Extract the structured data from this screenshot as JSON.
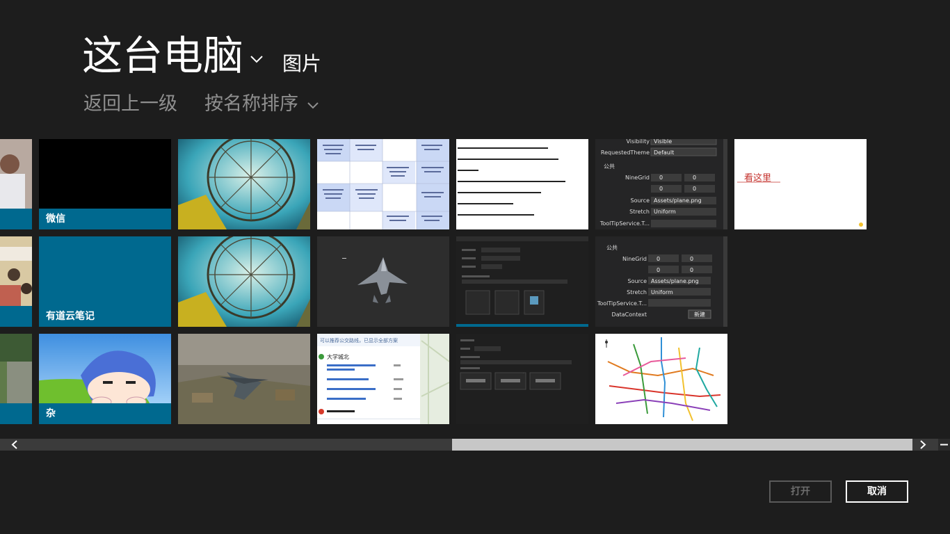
{
  "header": {
    "location_title": "这台电脑",
    "location_subtitle": "图片",
    "back_label": "返回上一级",
    "sort_label": "按名称排序"
  },
  "tiles": {
    "wechat_label": "微信",
    "youdao_label": "有道云笔记",
    "misc_label": "杂",
    "vs_row1_visibility_label": "Visibility",
    "vs_row1_visibility_value": "Visible",
    "vs_row1_theme_label": "RequestedTheme",
    "vs_row1_theme_value": "Default",
    "vs_common_label": "公共",
    "vs_ninegrid_label": "NineGrid",
    "vs_source_label": "Source",
    "vs_source_value": "Assets/plane.png",
    "vs_stretch_label": "Stretch",
    "vs_stretch_value": "Uniform",
    "vs_tooltip_label": "ToolTipService.T...",
    "vs_datacontext_label": "DataContext",
    "vs_new_button": "新建",
    "vs_zero": "0",
    "note_text": "看这里",
    "map_header": "可以推荐公交路线，已显示全部方案",
    "map_stop_1": "大学城北"
  },
  "buttons": {
    "open_label": "打开",
    "cancel_label": "取消"
  },
  "colors": {
    "background": "#1d1d1d",
    "folder_accent": "#00698f",
    "dim_text": "#8f8f8f"
  }
}
